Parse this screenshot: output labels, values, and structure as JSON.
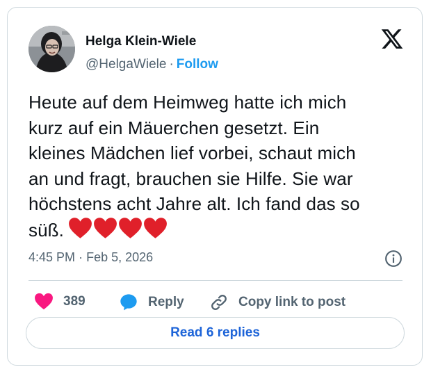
{
  "author": {
    "name": "Helga Klein-Wiele",
    "handle": "@HelgaWiele",
    "separator": "·",
    "follow_label": "Follow"
  },
  "tweet": {
    "lines": [
      "Heute auf dem Heimweg hatte ich mich",
      "kurz auf ein Mäuerchen gesetzt. Ein",
      "kleines Mädchen lief vorbei, schaut mich",
      "an und fragt, brauchen sie Hilfe. Sie war",
      "höchstens acht Jahre alt. Ich fand das so",
      "süß."
    ],
    "emoji": [
      "heart",
      "heart",
      "heart",
      "heart"
    ]
  },
  "meta": {
    "time": "4:45 PM",
    "separator": "·",
    "date": "Feb 5, 2026"
  },
  "actions": {
    "like_count": "389",
    "reply_label": "Reply",
    "copy_label": "Copy link to post"
  },
  "read_replies_label": "Read 6 replies",
  "colors": {
    "accent_blue": "#1d9bf0",
    "heart_pink": "#f91880",
    "emoji_red": "#e0202a",
    "muted_text": "#536471"
  }
}
